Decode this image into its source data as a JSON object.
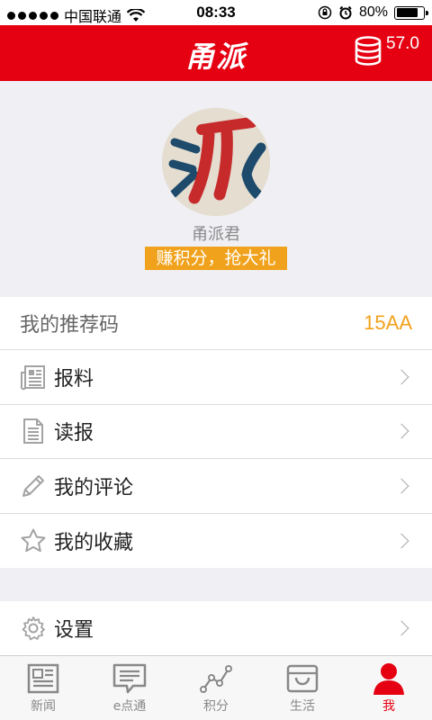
{
  "status_bar": {
    "carrier": "中国联通",
    "time": "08:33",
    "battery": "80%",
    "battery_level": 0.8
  },
  "header": {
    "logo": "甬派",
    "coin_icon": "coin-stack-icon",
    "coins": "57.0"
  },
  "profile": {
    "avatar_icon": "pai-logo-avatar",
    "username": "甬派君",
    "earn_banner": "赚积分，抢大礼"
  },
  "referral": {
    "label": "我的推荐码",
    "code": "15AA"
  },
  "menu": [
    {
      "label": "报料",
      "icon": "newspaper-icon"
    },
    {
      "label": "读报",
      "icon": "document-icon"
    },
    {
      "label": "我的评论",
      "icon": "pencil-icon"
    },
    {
      "label": "我的收藏",
      "icon": "star-icon"
    }
  ],
  "settings": {
    "label": "设置",
    "icon": "gear-icon"
  },
  "tabs": [
    {
      "label": "新闻",
      "icon": "news-icon"
    },
    {
      "label": "e点通",
      "icon": "message-icon"
    },
    {
      "label": "积分",
      "icon": "trend-icon"
    },
    {
      "label": "生活",
      "icon": "basket-icon"
    },
    {
      "label": "我",
      "icon": "user-icon",
      "active": true
    }
  ],
  "colors": {
    "brand_red": "#e50012",
    "accent_orange": "#f1a21c"
  }
}
